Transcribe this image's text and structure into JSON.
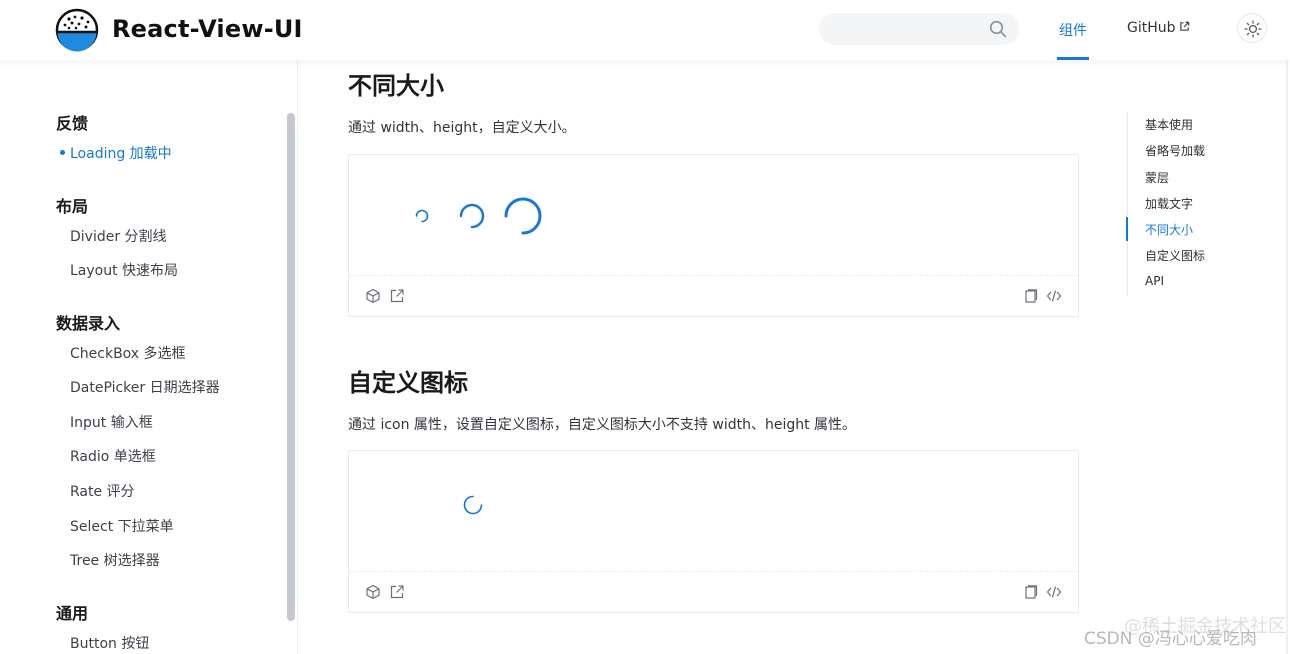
{
  "header": {
    "brand": "React-View-UI",
    "search_placeholder": "",
    "nav": {
      "components": "组件",
      "github": "GitHub"
    }
  },
  "sidebar": {
    "groups": [
      {
        "title": "反馈",
        "items": [
          {
            "label": "Loading 加载中",
            "active": true
          }
        ]
      },
      {
        "title": "布局",
        "items": [
          {
            "label": "Divider 分割线"
          },
          {
            "label": "Layout 快速布局"
          }
        ]
      },
      {
        "title": "数据录入",
        "items": [
          {
            "label": "CheckBox 多选框"
          },
          {
            "label": "DatePicker 日期选择器"
          },
          {
            "label": "Input 输入框"
          },
          {
            "label": "Radio 单选框"
          },
          {
            "label": "Rate 评分"
          },
          {
            "label": "Select 下拉菜单"
          },
          {
            "label": "Tree 树选择器"
          }
        ]
      },
      {
        "title": "通用",
        "items": [
          {
            "label": "Button 按钮"
          }
        ]
      }
    ]
  },
  "main": {
    "sections": [
      {
        "title": "不同大小",
        "desc": "通过 width、height，自定义大小。"
      },
      {
        "title": "自定义图标",
        "desc": "通过 icon 属性，设置自定义图标，自定义图标大小不支持 width、height 属性。"
      }
    ]
  },
  "toc": {
    "items": [
      "基本使用",
      "省略号加载",
      "蒙层",
      "加载文字",
      "不同大小",
      "自定义图标",
      "API"
    ],
    "active_index": 4
  },
  "watermark": {
    "csdn": "CSDN @冯心心爱吃肉",
    "juejin": "@稀土掘金技术社区"
  },
  "colors": {
    "accent": "#1677d4"
  }
}
